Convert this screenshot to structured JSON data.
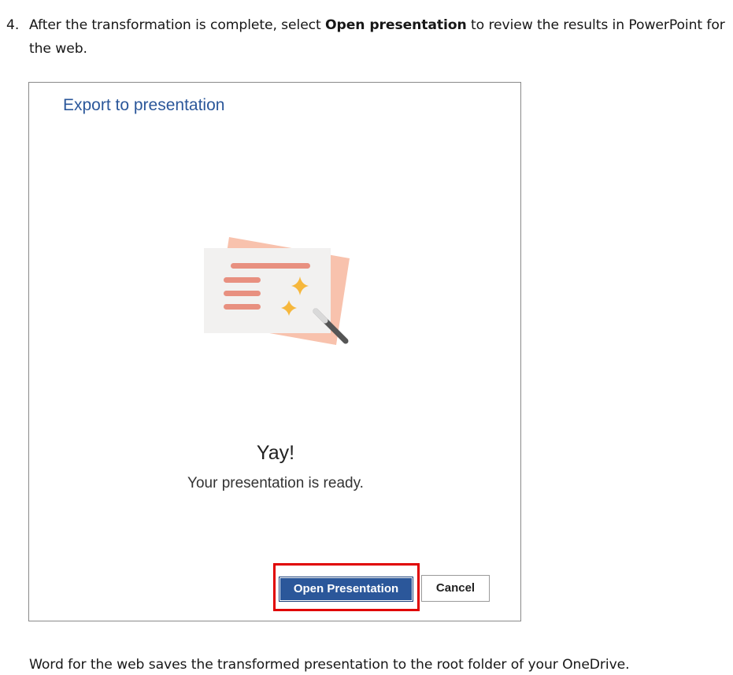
{
  "step": {
    "number": "4.",
    "text_before": "After the transformation is complete, select ",
    "bold": "Open presentation",
    "text_after": " to review the results in PowerPoint for the web."
  },
  "dialog": {
    "title": "Export to presentation",
    "illustration_icon": "presentation-sparkle-wand-icon",
    "heading": "Yay!",
    "message": "Your presentation is ready.",
    "primary_button": "Open Presentation",
    "secondary_button": "Cancel",
    "colors": {
      "title": "#2b579a",
      "primary_button_bg": "#2b579a",
      "highlight_border": "#e00000"
    }
  },
  "footer_text": "Word for the web saves the transformed presentation to the root folder of your OneDrive."
}
